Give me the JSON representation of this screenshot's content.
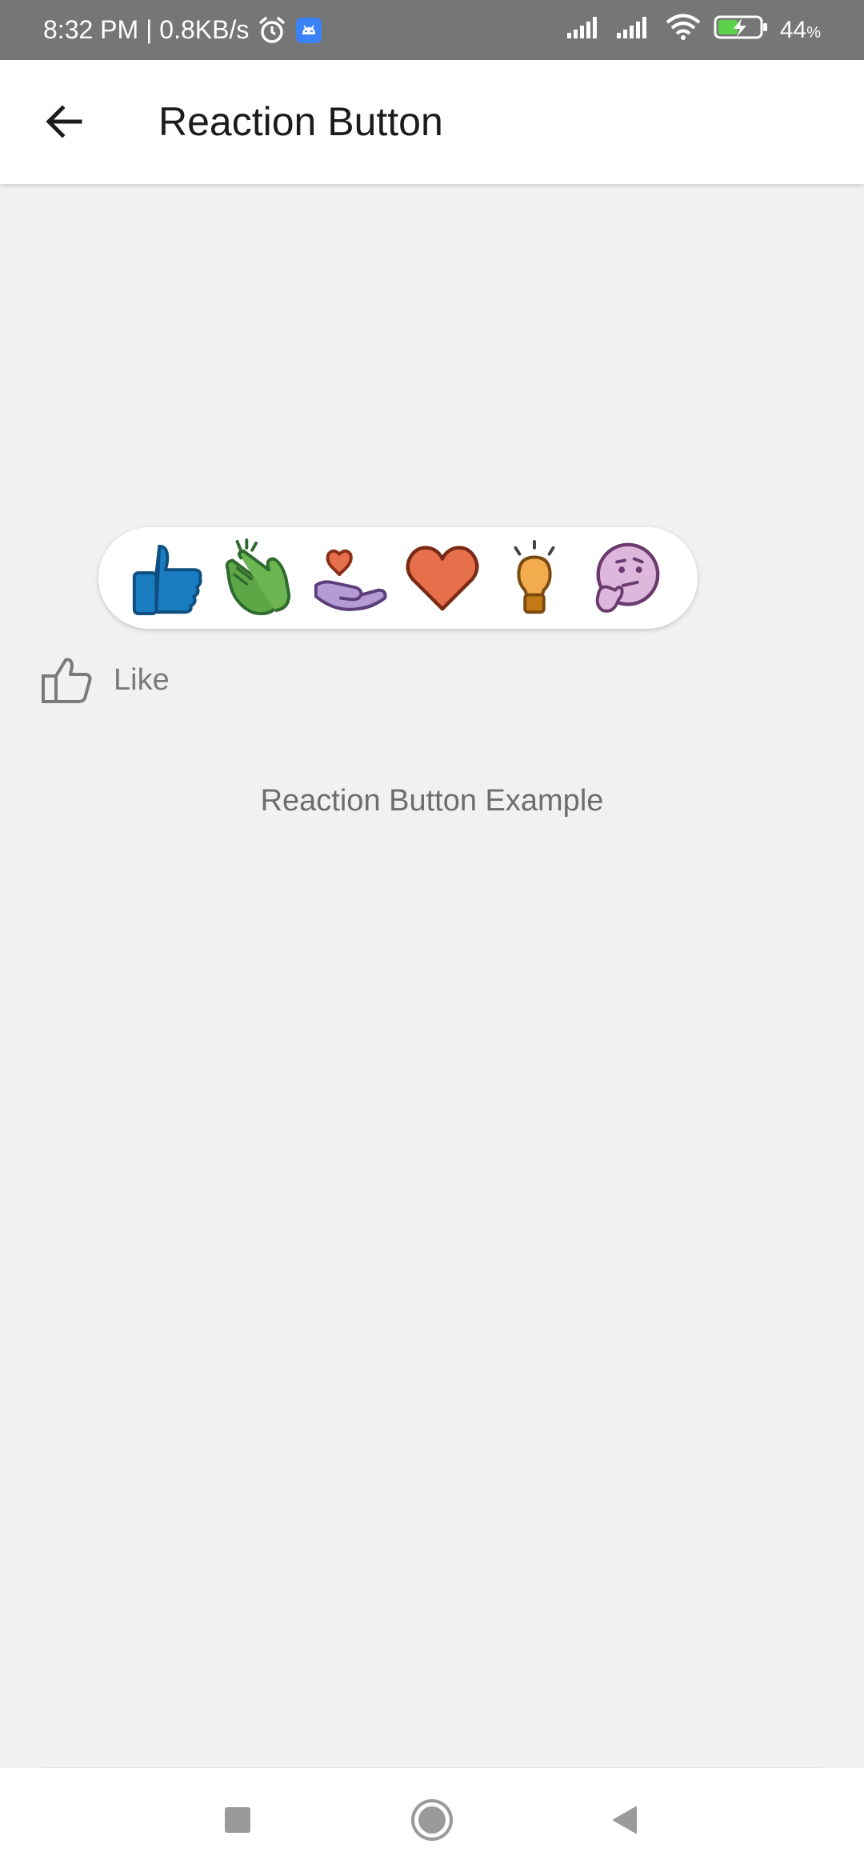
{
  "status_bar": {
    "time_speed": "8:32 PM | 0.8KB/s",
    "battery_level": "44",
    "battery_unit": "%",
    "icons": [
      "alarm-icon",
      "android-notification-icon",
      "signal-icon",
      "signal-icon",
      "wifi-icon",
      "battery-charging-icon"
    ]
  },
  "app_bar": {
    "title": "Reaction Button",
    "back_icon": "arrow-left-icon"
  },
  "reactions": [
    {
      "name": "thumbs-up",
      "color": "#1a7dc1"
    },
    {
      "name": "clapping-hands",
      "color": "#5ea646"
    },
    {
      "name": "heart-in-hand",
      "color": "#b59bd1"
    },
    {
      "name": "heart",
      "color": "#e5704b"
    },
    {
      "name": "light-bulb",
      "color": "#f2ac4e"
    },
    {
      "name": "thinking-face",
      "color": "#ddb8dc"
    }
  ],
  "like_button": {
    "label": "Like",
    "icon": "thumbs-up-outline-icon",
    "color": "#7a7a7a"
  },
  "content": {
    "example_text": "Reaction Button Example"
  },
  "nav_bar": {
    "buttons": [
      "recents-square-icon",
      "home-circle-icon",
      "back-triangle-icon"
    ]
  },
  "colors": {
    "status_bar_bg": "#767676",
    "background": "#f1f1f1",
    "app_bar_bg": "#ffffff"
  }
}
